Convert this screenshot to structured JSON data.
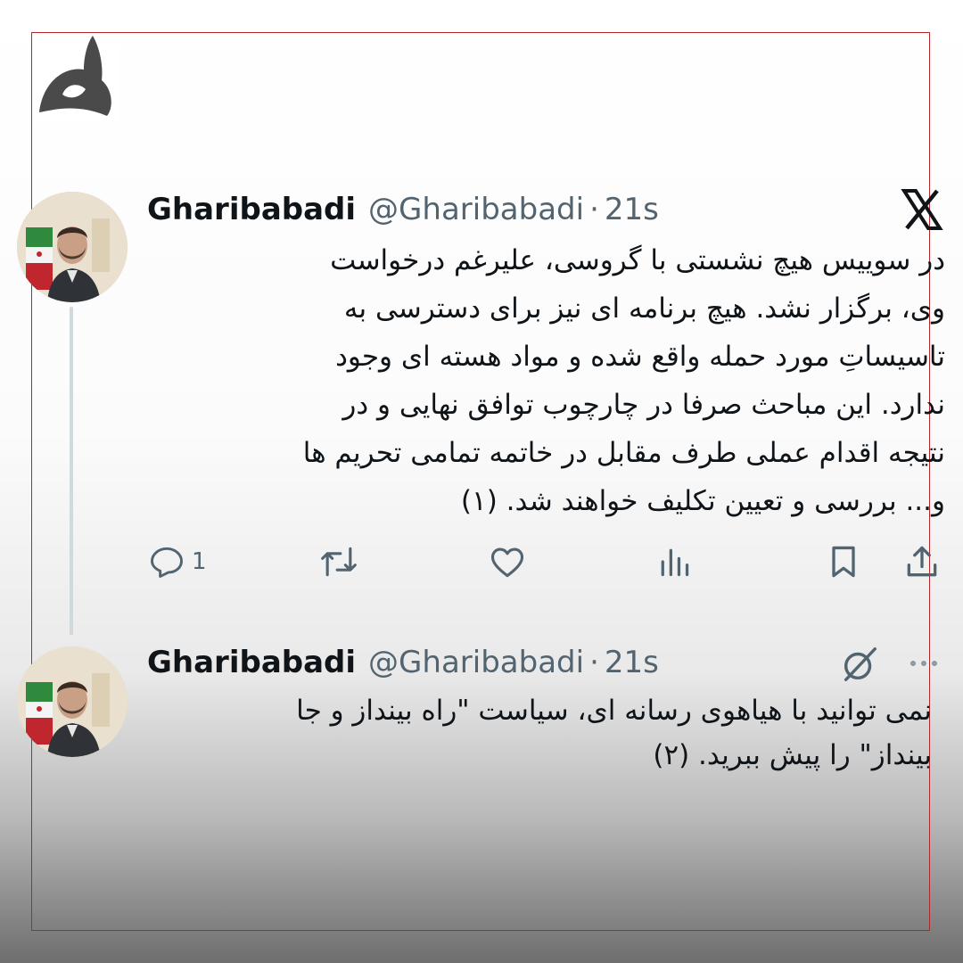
{
  "colors": {
    "text": "#0f1419",
    "secondary": "#536471",
    "frame": "#b3262a",
    "thread_line": "#cfd9de"
  },
  "tweets": [
    {
      "author": "Gharibabadi",
      "handle": "@Gharibabadi",
      "separator": "·",
      "time": "21s",
      "text_lines": [
        "در سوییس هیچ نشستی با گروسی، علیرغم درخواست",
        "وی، برگزار نشد. هیچ برنامه ای نیز برای دسترسی به",
        "تاسیساتِ مورد حمله واقع شده و مواد هسته ای وجود",
        "ندارد. این مباحث صرفا در چارچوب توافق نهایی و در",
        "نتیجه اقدام عملی طرف مقابل در خاتمه تمامی تحریم ها",
        "و... بررسی و تعیین تکلیف خواهند شد. (۱)"
      ],
      "reply_count": "1",
      "icons": [
        "reply-icon",
        "retweet-icon",
        "like-icon",
        "views-icon",
        "bookmark-icon",
        "share-icon"
      ]
    },
    {
      "author": "Gharibabadi",
      "handle": "@Gharibabadi",
      "separator": "·",
      "time": "21s",
      "text_lines": [
        "نمی توانید با هیاهوی رسانه ای، سیاست \"راه بینداز و جا",
        "بینداز\" را پیش ببرید. (۲)"
      ],
      "icons": [
        "grok-icon",
        "more-icon"
      ]
    }
  ],
  "brand_icons": [
    "x-logo-icon",
    "channel-logo-icon"
  ]
}
